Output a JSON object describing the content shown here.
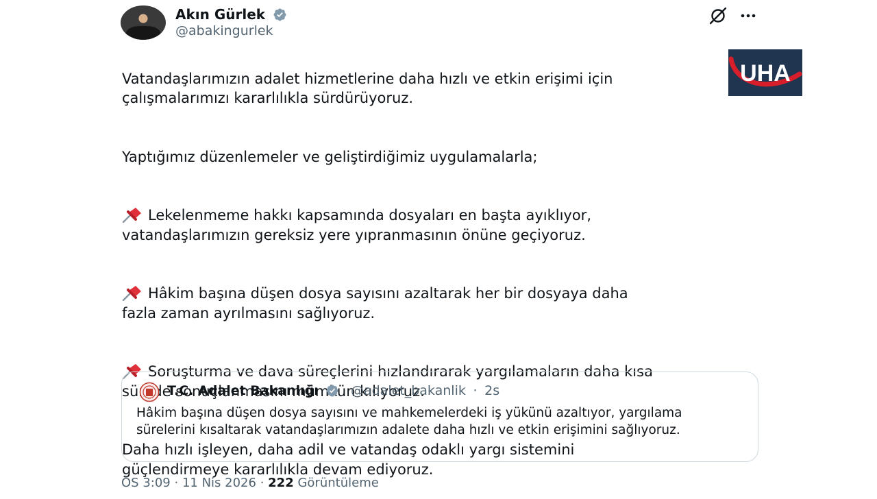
{
  "author": {
    "display_name": "Akın Gürlek",
    "handle": "@abakingurlek"
  },
  "tweet": {
    "paragraphs": [
      {
        "pin": false,
        "text": "Vatandaşlarımızın adalet hizmetlerine daha hızlı ve etkin erişimi için\nçalışmalarımızı kararlılıkla sürdürüyoruz."
      },
      {
        "pin": false,
        "text": "Yaptığımız düzenlemeler ve geliştirdiğimiz uygulamalarla;"
      },
      {
        "pin": true,
        "text": "Lekelenmeme hakkı kapsamında dosyaları en başta ayıklıyor,\nvatandaşlarımızın gereksiz yere yıpranmasının önüne geçiyoruz."
      },
      {
        "pin": true,
        "text": "Hâkim başına düşen dosya sayısını azaltarak her bir dosyaya daha\nfazla zaman ayrılmasını sağlıyoruz."
      },
      {
        "pin": true,
        "text": "Soruşturma ve dava süreçlerini hızlandırarak yargılamaların daha kısa\nsürede sonuçlanmasını mümkün kılıyoruz."
      },
      {
        "pin": false,
        "text": "Daha hızlı işleyen, daha adil ve vatandaş odaklı yargı sistemini\ngüçlendirmeye kararlılıkla devam ediyoruz."
      }
    ]
  },
  "quote": {
    "display_name": "T.C. Adalet Bakanlığı",
    "handle": "@adalet_bakanlik",
    "separator": "·",
    "time": "2s",
    "text": "Hâkim başına düşen dosya sayısını ve mahkemelerdeki iş yükünü azaltıyor, yargılama sürelerini kısaltarak vatandaşlarımızın adalete daha hızlı ve etkin erişimini sağlıyoruz."
  },
  "meta": {
    "time": "ÖS 3:09",
    "sep1": "·",
    "date": "11 Nis 2026",
    "sep2": "·",
    "views_count": "222",
    "views_label": "Görüntüleme"
  },
  "watermark": {
    "text": "UHA",
    "bg_color": "#1f3550",
    "accent_color": "#d81e2a"
  },
  "colors": {
    "text": "#0f1419",
    "secondary": "#536471",
    "verified_badge": "#829aab",
    "border": "#cfd9de"
  }
}
